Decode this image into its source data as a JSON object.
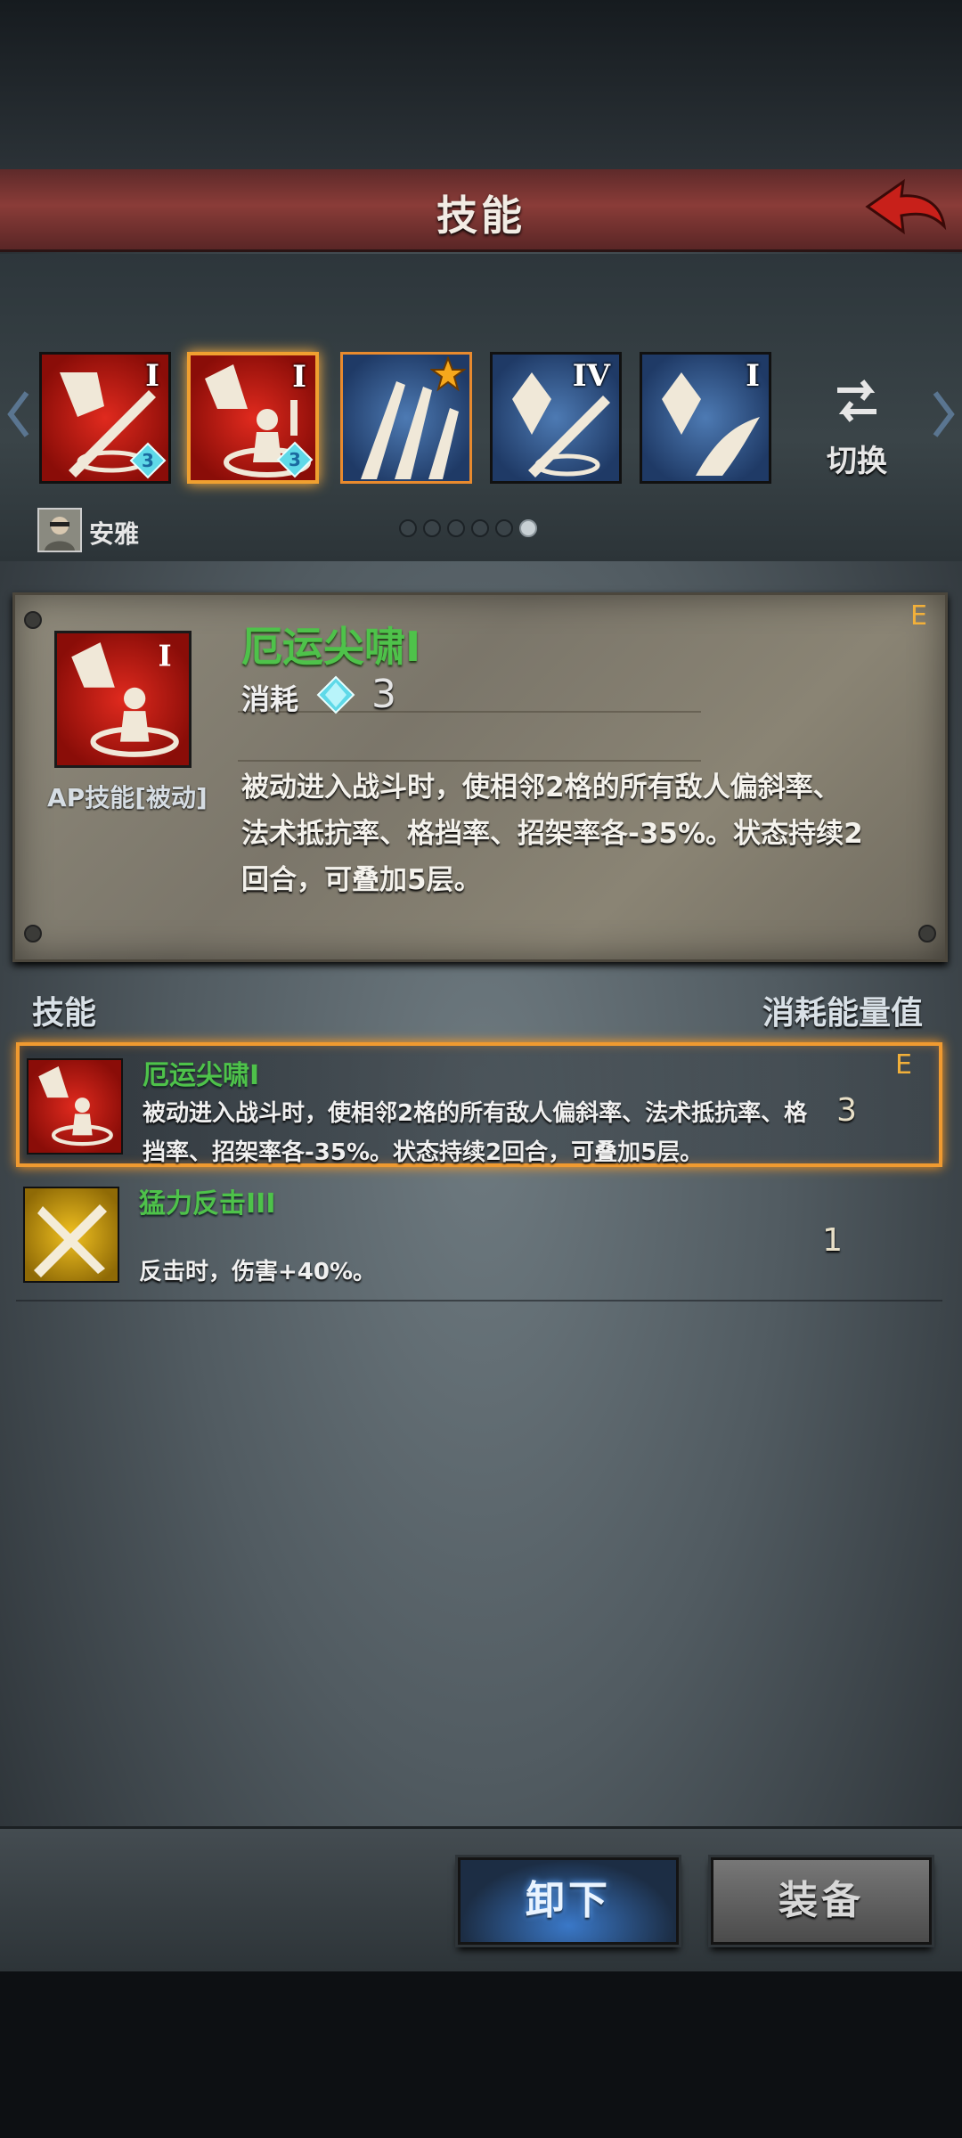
{
  "header": {
    "title": "技能"
  },
  "skill_slots": [
    {
      "level": "I",
      "badge": "3",
      "color": "red"
    },
    {
      "level": "I",
      "badge": "3",
      "color": "red",
      "selected": true
    },
    {
      "level": "",
      "badge": "",
      "color": "blue",
      "star": true
    },
    {
      "level": "IV",
      "badge": "",
      "color": "blue"
    },
    {
      "level": "I",
      "badge": "",
      "color": "blue"
    }
  ],
  "switch_label": "切换",
  "character": {
    "name": "安雅"
  },
  "page_dots": {
    "total": 6,
    "active_index": 5
  },
  "detail": {
    "name": "厄运尖啸I",
    "cost_label": "消耗",
    "cost_value": "3",
    "type_label": "AP技能[被动]",
    "grade": "E",
    "description": "被动进入战斗时，使相邻2格的所有敌人偏斜率、法术抵抗率、格挡率、招架率各-35%。状态持续2回合，可叠加5层。"
  },
  "list_header": {
    "left": "技能",
    "right": "消耗能量值"
  },
  "skill_list": [
    {
      "name": "厄运尖啸I",
      "description": "被动进入战斗时，使相邻2格的所有敌人偏斜率、法术抵抗率、格挡率、招架率各-35%。状态持续2回合，可叠加5层。",
      "cost": "3",
      "grade": "E",
      "selected": true
    },
    {
      "name": "猛力反击III",
      "description": "反击时，伤害+40%。",
      "cost": "1",
      "grade": ""
    }
  ],
  "buttons": {
    "unequip": "卸下",
    "equip": "装备"
  },
  "colors": {
    "skill_name": "#4ec24a",
    "grade": "#f2b03a",
    "accent": "#f09a30"
  }
}
